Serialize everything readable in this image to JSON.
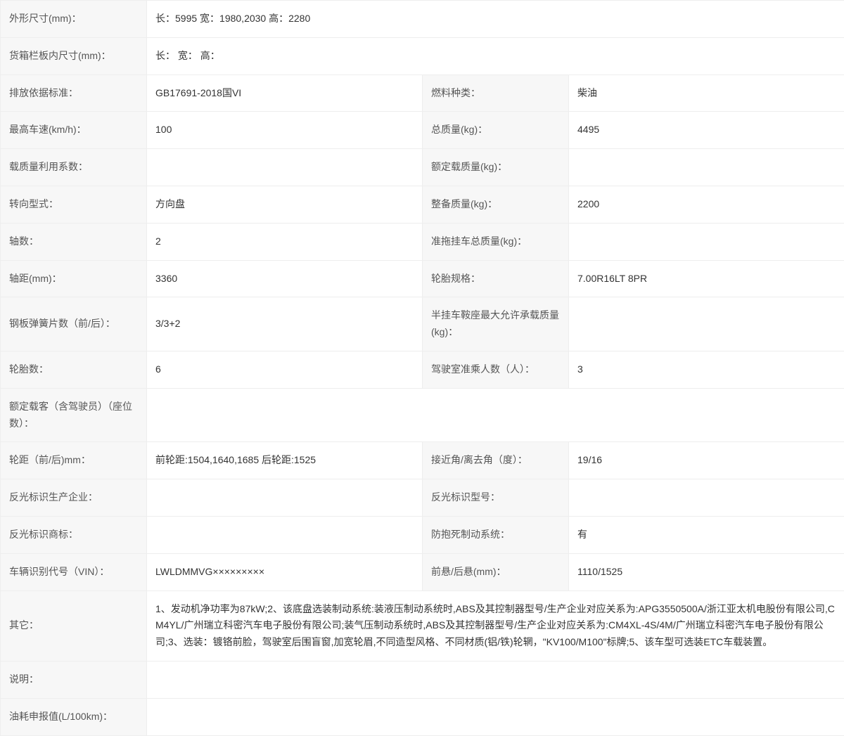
{
  "rows": [
    {
      "type": "single",
      "label": "外形尺寸(mm)：",
      "value": "长：5995 宽：1980,2030 高：2280"
    },
    {
      "type": "single",
      "label": "货箱栏板内尺寸(mm)：",
      "value": "长： 宽： 高："
    },
    {
      "type": "double",
      "label1": "排放依据标准：",
      "value1": "GB17691-2018国VI",
      "label2": "燃料种类：",
      "value2": "柴油"
    },
    {
      "type": "double",
      "label1": "最高车速(km/h)：",
      "value1": "100",
      "label2": "总质量(kg)：",
      "value2": "4495"
    },
    {
      "type": "double",
      "label1": "载质量利用系数：",
      "value1": "",
      "label2": "额定载质量(kg)：",
      "value2": ""
    },
    {
      "type": "double",
      "label1": "转向型式：",
      "value1": "方向盘",
      "label2": "整备质量(kg)：",
      "value2": "2200"
    },
    {
      "type": "double",
      "label1": "轴数：",
      "value1": "2",
      "label2": "准拖挂车总质量(kg)：",
      "value2": ""
    },
    {
      "type": "double",
      "label1": "轴距(mm)：",
      "value1": "3360",
      "label2": "轮胎规格：",
      "value2": "7.00R16LT 8PR"
    },
    {
      "type": "double",
      "label1": "钢板弹簧片数（前/后）：",
      "value1": "3/3+2",
      "label2": "半挂车鞍座最大允许承载质量(kg)：",
      "value2": ""
    },
    {
      "type": "double",
      "label1": "轮胎数：",
      "value1": "6",
      "label2": "驾驶室准乘人数（人）：",
      "value2": "3"
    },
    {
      "type": "single",
      "label": "额定载客（含驾驶员）（座位数）：",
      "value": ""
    },
    {
      "type": "double",
      "label1": "轮距（前/后)mm：",
      "value1": "前轮距:1504,1640,1685 后轮距:1525",
      "label2": "接近角/离去角（度）：",
      "value2": "19/16"
    },
    {
      "type": "double",
      "label1": "反光标识生产企业：",
      "value1": "",
      "label2": "反光标识型号：",
      "value2": ""
    },
    {
      "type": "double",
      "label1": "反光标识商标：",
      "value1": "",
      "label2": "防抱死制动系统：",
      "value2": "有"
    },
    {
      "type": "double",
      "label1": "车辆识别代号（VIN）：",
      "value1": "LWLDMMVG×××××××××",
      "label2": "前悬/后悬(mm)：",
      "value2": "1110/1525"
    },
    {
      "type": "single",
      "label": "其它：",
      "value": "1、发动机净功率为87kW;2、该底盘选装制动系统:装液压制动系统时,ABS及其控制器型号/生产企业对应关系为:APG3550500A/浙江亚太机电股份有限公司,CM4YL/广州瑞立科密汽车电子股份有限公司;装气压制动系统时,ABS及其控制器型号/生产企业对应关系为:CM4XL-4S/4M/广州瑞立科密汽车电子股份有限公司;3、选装：镀铬前脸，驾驶室后围盲窗,加宽轮眉,不同造型风格、不同材质(铝/铁)轮辋，\"KV100/M100\"标牌;5、该车型可选装ETC车载装置。"
    },
    {
      "type": "single",
      "label": "说明：",
      "value": ""
    },
    {
      "type": "single",
      "label": "油耗申报值(L/100km)：",
      "value": ""
    }
  ]
}
